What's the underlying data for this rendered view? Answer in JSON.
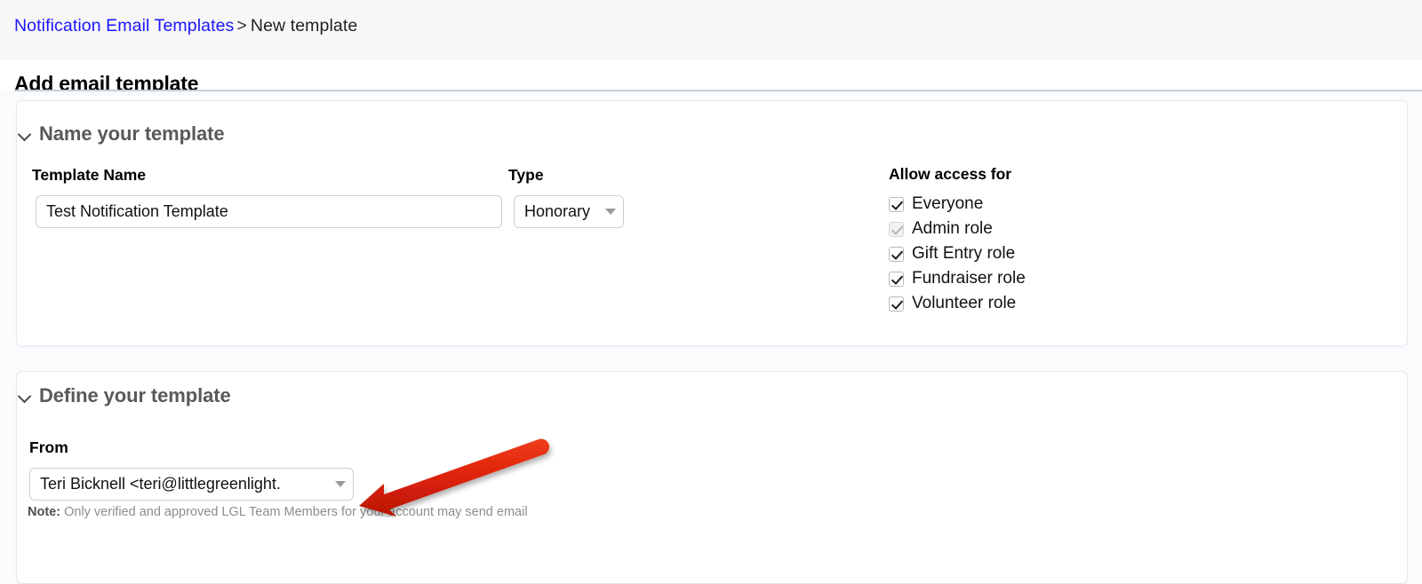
{
  "breadcrumb": {
    "link_label": "Notification Email Templates",
    "separator": ">",
    "current_label": "New template"
  },
  "page": {
    "title": "Add email template"
  },
  "sections": [
    {
      "id": "name-your-template",
      "title": "Name your template",
      "chevron_icon": "chevron-down-icon",
      "fields": {
        "template_name": {
          "label": "Template Name",
          "value": "Test Notification Template",
          "placeholder": ""
        },
        "type": {
          "label": "Type",
          "selected": "Honorary",
          "caret_icon": "caret-down-icon"
        },
        "access": {
          "legend": "Allow access for",
          "options": [
            {
              "label": "Everyone",
              "checked": true,
              "disabled": false
            },
            {
              "label": "Admin role",
              "checked": true,
              "disabled": true
            },
            {
              "label": "Gift Entry role",
              "checked": true,
              "disabled": false
            },
            {
              "label": "Fundraiser role",
              "checked": true,
              "disabled": false
            },
            {
              "label": "Volunteer role",
              "checked": true,
              "disabled": false
            }
          ]
        }
      }
    },
    {
      "id": "define-your-template",
      "title": "Define your template",
      "chevron_icon": "chevron-down-icon",
      "fields": {
        "from": {
          "label": "From",
          "selected": "Teri Bicknell <teri@littlegreenlight.",
          "caret_icon": "caret-down-icon",
          "note_prefix": "Note:",
          "note_text": "Only verified and approved LGL Team Members for your account may send email"
        }
      }
    }
  ],
  "annotation": {
    "arrow_icon": "red-arrow-pointing-left",
    "color": "#dd2209",
    "points_at": "from-select"
  },
  "colors": {
    "link": "#1a16ff",
    "header_band": "#f7f7f8",
    "page_background": "#fafbfc",
    "card_border": "#e3e9f0",
    "section_title": "#58595b",
    "annotation_red": "#dd2209"
  }
}
